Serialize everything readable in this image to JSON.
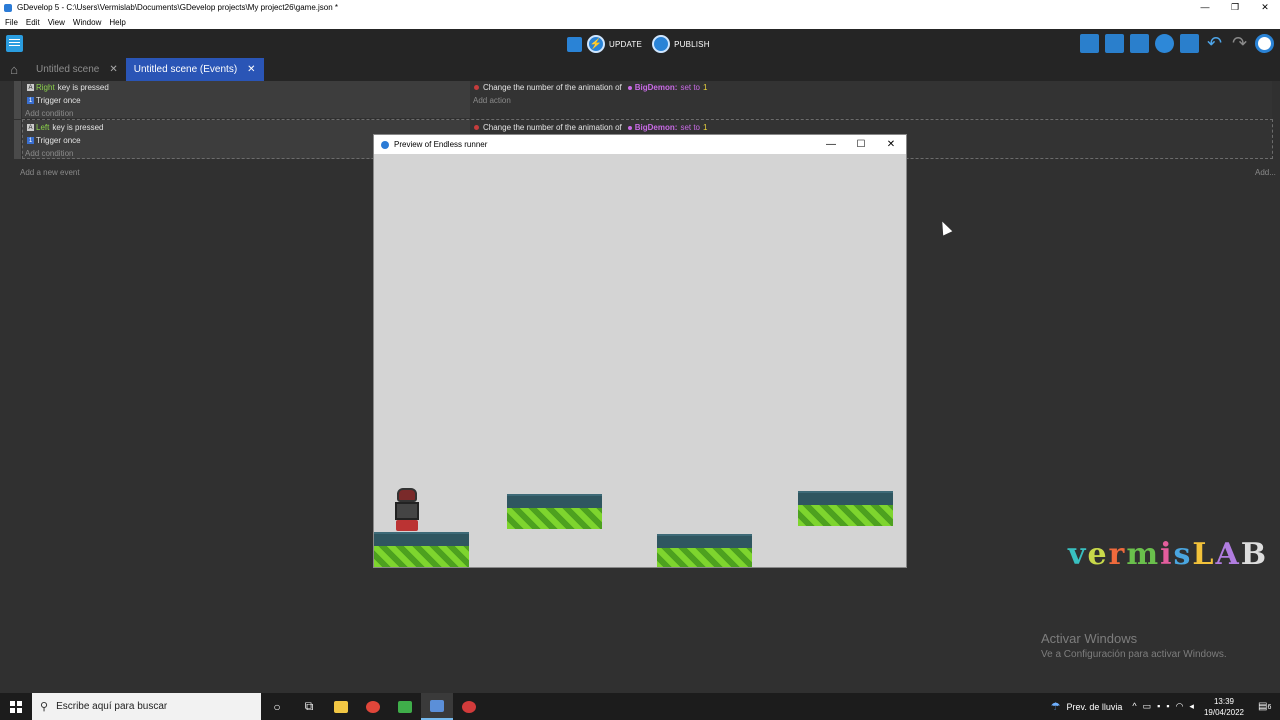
{
  "window": {
    "title": "GDevelop 5 - C:\\Users\\Vermislab\\Documents\\GDevelop projects\\My project26\\game.json *",
    "minimize": "—",
    "maximize": "❐",
    "close": "✕"
  },
  "menubar": {
    "items": [
      "File",
      "Edit",
      "View",
      "Window",
      "Help"
    ]
  },
  "toolbar": {
    "update_label": "UPDATE",
    "publish_label": "PUBLISH"
  },
  "tabs": [
    {
      "label": "Untitled scene",
      "close": "✕"
    },
    {
      "label": "Untitled scene (Events)",
      "close": "✕"
    }
  ],
  "events": [
    {
      "key": "Right",
      "condition_text": "key is pressed",
      "trigger": "Trigger once",
      "add_condition": "Add condition",
      "action_text": "Change the number of the animation of",
      "action_object": "BigDemon:",
      "action_op": "set to",
      "action_value": "1",
      "add_action": "Add action"
    },
    {
      "key": "Left",
      "condition_text": "key is pressed",
      "trigger": "Trigger once",
      "add_condition": "Add condition",
      "action_text": "Change the number of the animation of",
      "action_object": "BigDemon:",
      "action_op": "set to",
      "action_value": "1"
    }
  ],
  "add_new_event": "Add a new event",
  "add_right": "Add...",
  "preview": {
    "title": "Preview of Endless runner",
    "minimize": "—",
    "maximize": "☐",
    "close": "✕"
  },
  "logo_text": "vermisLAB",
  "watermark": {
    "line1": "Activar Windows",
    "line2": "Ve a Configuración para activar Windows."
  },
  "taskbar": {
    "search_placeholder": "Escribe aquí para buscar",
    "weather": "Prev. de lluvia",
    "time": "13:39",
    "date": "19/04/2022",
    "notification_count": "6"
  },
  "colors": {
    "accent": "#2a55b6",
    "keyword": "#8bd34a",
    "object": "#c96ae6",
    "value": "#e9d23c"
  }
}
